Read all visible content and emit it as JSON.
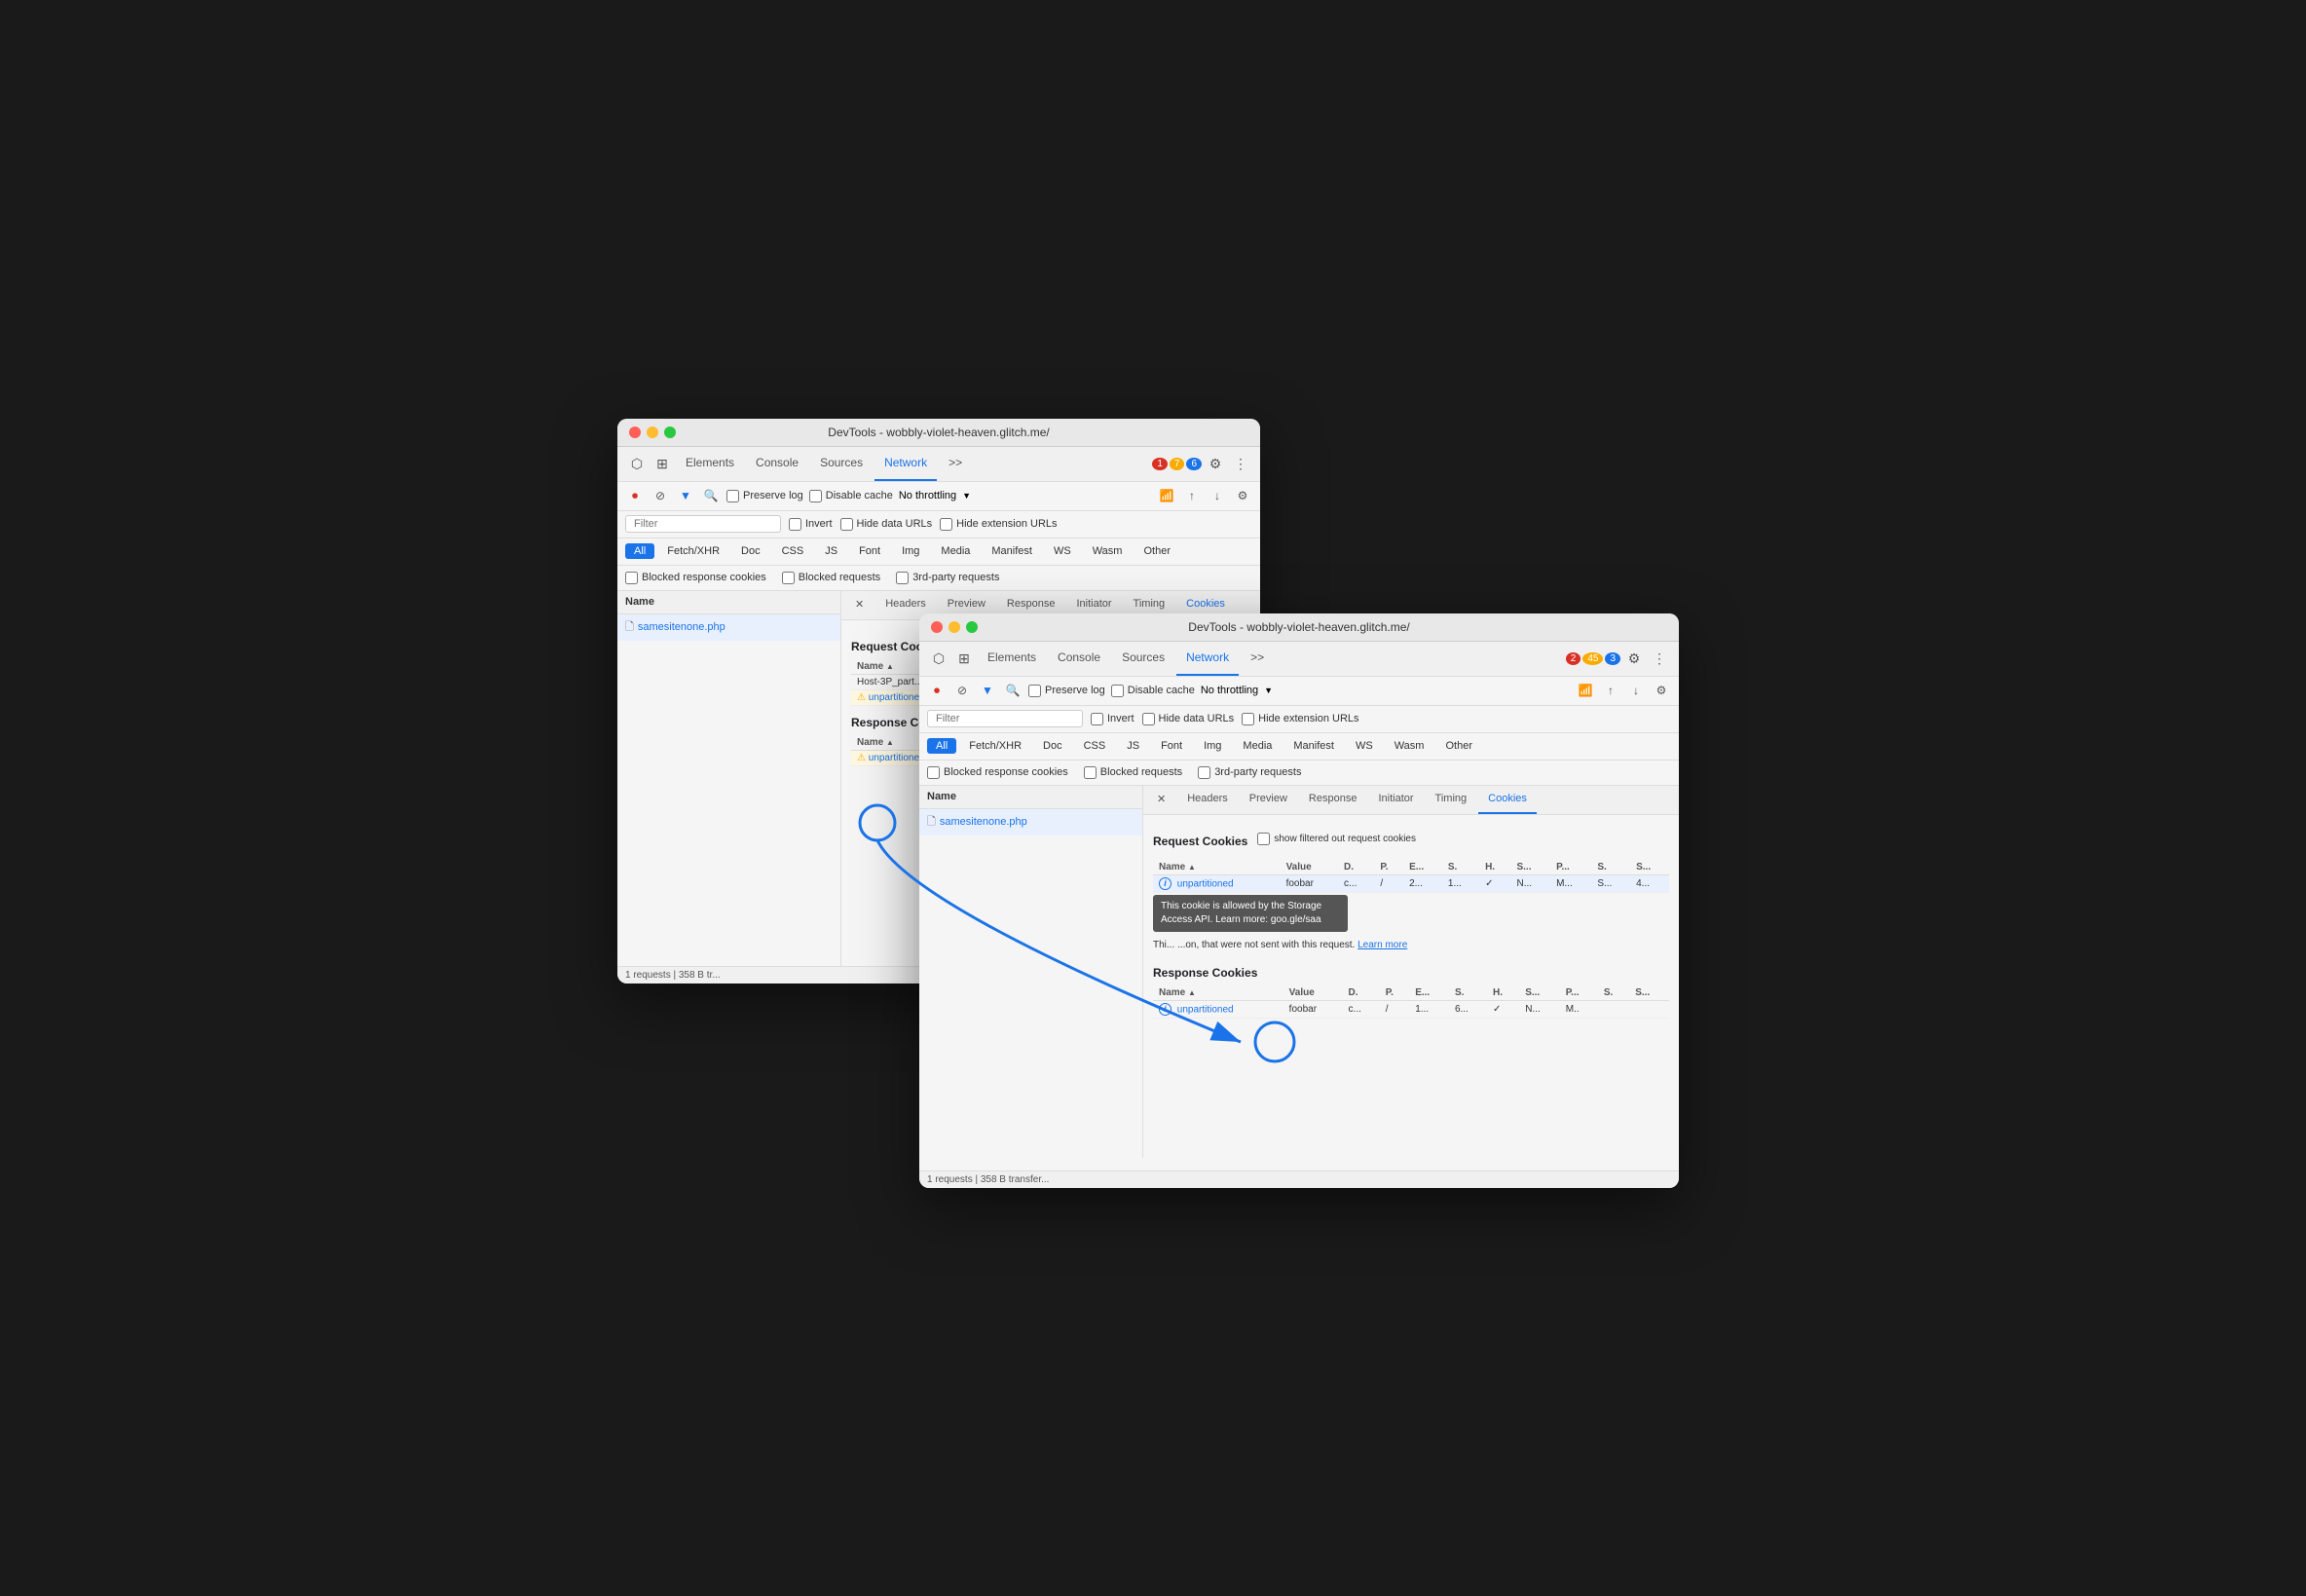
{
  "window1": {
    "title": "DevTools - wobbly-violet-heaven.glitch.me/",
    "tabs": [
      "Elements",
      "Console",
      "Sources",
      "Network",
      ">>"
    ],
    "active_tab": "Network",
    "badges": {
      "errors": "1",
      "warnings": "7",
      "info": "6"
    },
    "network_toolbar": {
      "preserve_log": "Preserve log",
      "disable_cache": "Disable cache",
      "throttling": "No throttling"
    },
    "filter_placeholder": "Filter",
    "filter_options": [
      "Invert",
      "Hide data URLs",
      "Hide extension URLs"
    ],
    "type_buttons": [
      "All",
      "Fetch/XHR",
      "Doc",
      "CSS",
      "JS",
      "Font",
      "Img",
      "Media",
      "Manifest",
      "WS",
      "Wasm",
      "Other"
    ],
    "active_type": "All",
    "checkboxes": [
      "Blocked response cookies",
      "Blocked requests",
      "3rd-party requests"
    ],
    "name_column": "Name",
    "file": "samesitenone.php",
    "detail_tabs": [
      "X",
      "Headers",
      "Preview",
      "Response",
      "Initiator",
      "Timing",
      "Cookies"
    ],
    "active_detail_tab": "Cookies",
    "request_cookies_title": "Request Cookies",
    "name_col": "Name",
    "cookies_rows_req": [
      {
        "name": "Host-3P_part...",
        "warn": false
      },
      {
        "name": "unpartitioned",
        "warn": true
      }
    ],
    "response_cookies_title": "Response Cookies",
    "cookies_rows_res": [
      {
        "name": "unpartitioned",
        "warn": true
      }
    ],
    "status_bar": "1 requests  |  358 B tr..."
  },
  "window2": {
    "title": "DevTools - wobbly-violet-heaven.glitch.me/",
    "tabs": [
      "Elements",
      "Console",
      "Sources",
      "Network",
      ">>"
    ],
    "active_tab": "Network",
    "badges": {
      "errors": "2",
      "warnings": "45",
      "info": "3"
    },
    "network_toolbar": {
      "preserve_log": "Preserve log",
      "disable_cache": "Disable cache",
      "throttling": "No throttling"
    },
    "filter_placeholder": "Filter",
    "filter_options": [
      "Invert",
      "Hide data URLs",
      "Hide extension URLs"
    ],
    "type_buttons": [
      "All",
      "Fetch/XHR",
      "Doc",
      "CSS",
      "JS",
      "Font",
      "Img",
      "Media",
      "Manifest",
      "WS",
      "Wasm",
      "Other"
    ],
    "active_type": "All",
    "checkboxes": [
      "Blocked response cookies",
      "Blocked requests",
      "3rd-party requests"
    ],
    "name_column": "Name",
    "file": "samesitenone.php",
    "detail_tabs": [
      "X",
      "Headers",
      "Preview",
      "Response",
      "Initiator",
      "Timing",
      "Cookies"
    ],
    "active_detail_tab": "Cookies",
    "request_cookies_title": "Request Cookies",
    "show_filtered_label": "show filtered out request cookies",
    "req_cols": [
      "Name",
      "Value",
      "D.",
      "P.",
      "E...",
      "S.",
      "H.",
      "S...",
      "P...",
      "S.",
      "S..."
    ],
    "req_row": {
      "icon": "ℹ",
      "name": "unpartitioned",
      "value": "foobar",
      "d": "c...",
      "p": "/",
      "e": "2...",
      "s1": "1...",
      "h": "✓",
      "s2": "N...",
      "p2": "M...",
      "s3": "S...",
      "s4": "4..."
    },
    "tooltip": "This cookie is allowed by the Storage Access API. Learn more: goo.gle/saa",
    "info_text": "Thi... ...on, that were not sent with this request.",
    "learn_more": "Learn more",
    "response_cookies_title": "Response Cookies",
    "res_cols": [
      "Name",
      "Value",
      "D.",
      "P.",
      "E...",
      "S.",
      "H.",
      "S...",
      "P...",
      "S.",
      "S..."
    ],
    "res_row": {
      "icon": "ℹ",
      "name": "unpartitioned",
      "value": "foobar",
      "d": "c...",
      "p": "/",
      "e": "1...",
      "s1": "6...",
      "h": "✓",
      "s2": "N...",
      "p2": "M.."
    },
    "status_bar": "1 requests  |  358 B transfer..."
  },
  "icons": {
    "record_stop": "⏺",
    "clear": "⊘",
    "filter": "▼",
    "search": "🔍",
    "close": "✕",
    "upload": "↑",
    "download": "↓",
    "settings": "⚙",
    "more": "⋮",
    "wifi": "📶",
    "cursor": "⬡",
    "layers": "⊞",
    "warning": "⚠",
    "info": "ℹ",
    "file": "🗋"
  }
}
